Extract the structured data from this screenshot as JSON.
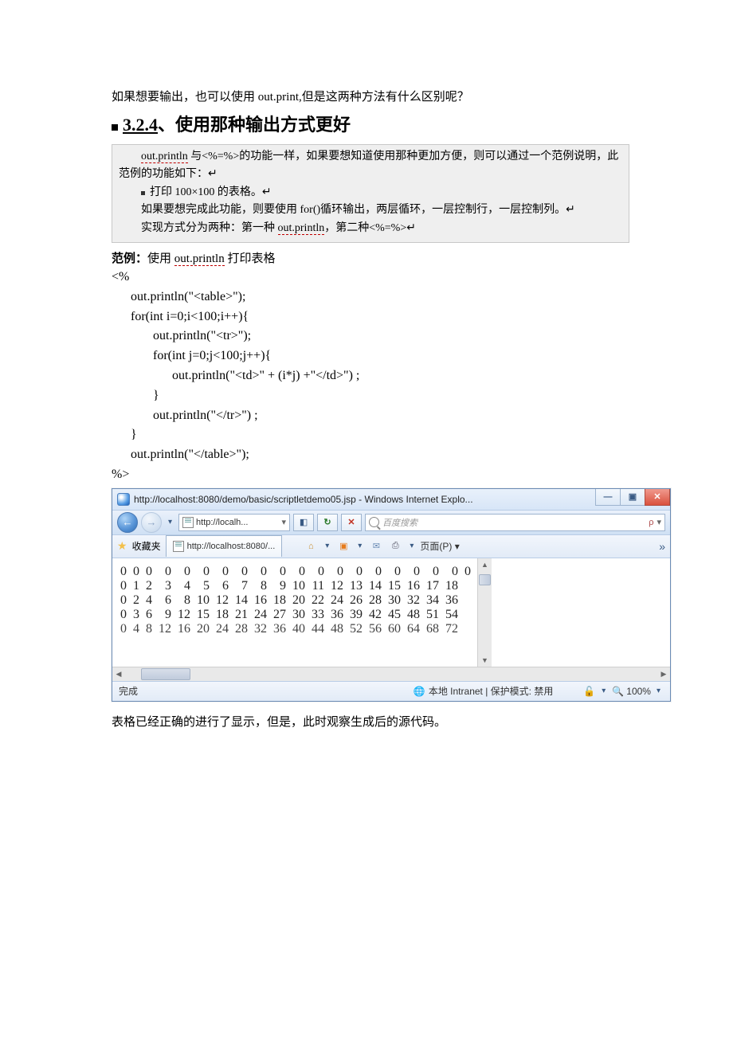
{
  "intro_text": "如果想要输出，也可以使用 out.print,但是这两种方法有什么区别呢？",
  "heading": {
    "number": "3.2.4",
    "sep": "、",
    "title": "使用那种输出方式更好"
  },
  "gray_box": {
    "line1_a": "out.println",
    "line1_b": " 与<%=%>的功能一样，如果要想知道使用那种更加方便，则可以通过一个范例说明，此范例的功能如下：↵",
    "bullet": "打印 100×100 的表格。↵",
    "line3": "如果要想完成此功能，则要使用 for()循环输出，两层循环，一层控制行，一层控制列。↵",
    "line4_a": "实现方式分为两种：第一种 ",
    "line4_b": "out.println",
    "line4_c": "，第二种<%=%>↵"
  },
  "example": {
    "label": "范例：",
    "text_a": "使用 ",
    "text_b": "out.println",
    "text_c": " 打印表格"
  },
  "code": "<%\n      out.println(\"<table>\");\n      for(int i=0;i<100;i++){\n             out.println(\"<tr>\");\n             for(int j=0;j<100;j++){\n                   out.println(\"<td>\" + (i*j) +\"</td>\") ;\n             }\n             out.println(\"</tr>\") ;\n      }\n      out.println(\"</table>\");\n%>",
  "browser": {
    "title": "http://localhost:8080/demo/basic/scriptletdemo05.jsp - Windows Internet Explo...",
    "address_short": "http://localh...",
    "search_placeholder": "百度搜索",
    "favorites_label": "收藏夹",
    "tab_label": "http://localhost:8080/...",
    "page_menu": "页面(P) ▾",
    "status_done": "完成",
    "status_zone": "本地 Intranet | 保护模式: 禁用",
    "status_zoom": "100%",
    "win_min": "—",
    "win_max": "▣",
    "win_close": "✕"
  },
  "chart_data": {
    "type": "table",
    "note": "Browser content showing first visible cells of a 100×100 multiplication-index table (cell = i*j). Rows 0–4, columns 0–18 visible.",
    "rows": [
      {
        "lead": "0",
        "cells": [
          0,
          0,
          0,
          0,
          0,
          0,
          0,
          0,
          0,
          0,
          0,
          0,
          0,
          0,
          0,
          0,
          0,
          0,
          0
        ]
      },
      {
        "lead": "0",
        "cells": [
          1,
          2,
          3,
          4,
          5,
          6,
          7,
          8,
          9,
          10,
          11,
          12,
          13,
          14,
          15,
          16,
          17,
          18
        ]
      },
      {
        "lead": "0",
        "cells": [
          2,
          4,
          6,
          8,
          10,
          12,
          14,
          16,
          18,
          20,
          22,
          24,
          26,
          28,
          30,
          32,
          34,
          36
        ]
      },
      {
        "lead": "0",
        "cells": [
          3,
          6,
          9,
          12,
          15,
          18,
          21,
          24,
          27,
          30,
          33,
          36,
          39,
          42,
          45,
          48,
          51,
          54
        ]
      },
      {
        "lead": "0",
        "cells": [
          4,
          8,
          12,
          16,
          20,
          24,
          28,
          32,
          36,
          40,
          44,
          48,
          52,
          56,
          60,
          64,
          68,
          72
        ]
      }
    ]
  },
  "outro_text": "表格已经正确的进行了显示，但是，此时观察生成后的源代码。"
}
